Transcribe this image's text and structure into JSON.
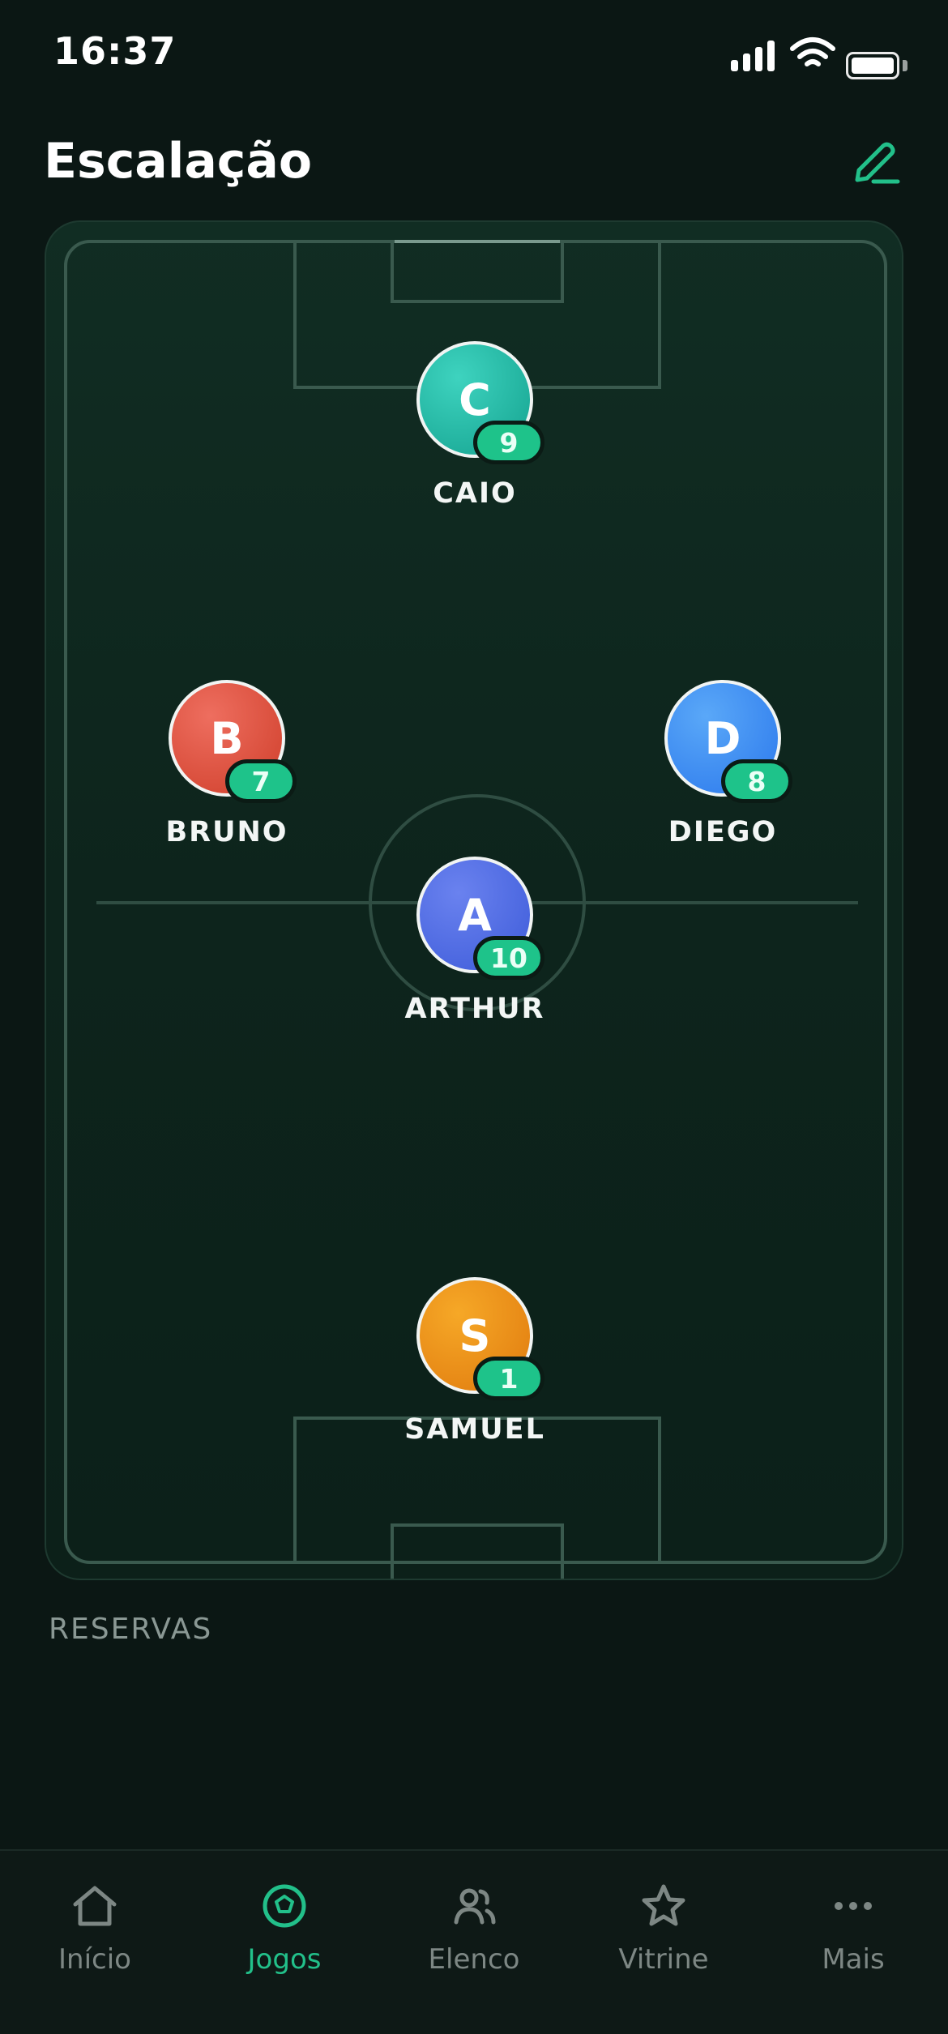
{
  "status_bar": {
    "time": "16:37"
  },
  "header": {
    "title": "Escalação",
    "edit_icon": "pencil-icon"
  },
  "players": [
    {
      "initial": "C",
      "number": "9",
      "name": "CAIO",
      "color_start": "#3ed3bf",
      "color_end": "#14a28f"
    },
    {
      "initial": "B",
      "number": "7",
      "name": "BRUNO",
      "color_start": "#ee6e5f",
      "color_end": "#cf3e2a"
    },
    {
      "initial": "D",
      "number": "8",
      "name": "DIEGO",
      "color_start": "#5aa8f8",
      "color_end": "#2b78ec"
    },
    {
      "initial": "A",
      "number": "10",
      "name": "ARTHUR",
      "color_start": "#6a82ef",
      "color_end": "#3d5bd9"
    },
    {
      "initial": "S",
      "number": "1",
      "name": "SAMUEL",
      "color_start": "#f6a827",
      "color_end": "#e07a0e"
    }
  ],
  "reserves": {
    "label": "RESERVAS"
  },
  "tab_bar": {
    "tabs": [
      {
        "label": "Início",
        "icon": "home-icon",
        "active": false
      },
      {
        "label": "Jogos",
        "icon": "soccer-ball-icon",
        "active": true
      },
      {
        "label": "Elenco",
        "icon": "users-icon",
        "active": false
      },
      {
        "label": "Vitrine",
        "icon": "star-icon",
        "active": false
      },
      {
        "label": "Mais",
        "icon": "more-icon",
        "active": false
      }
    ]
  },
  "colors": {
    "accent": "#22c08a",
    "background": "#0b1714",
    "inactive": "#7d8784"
  }
}
